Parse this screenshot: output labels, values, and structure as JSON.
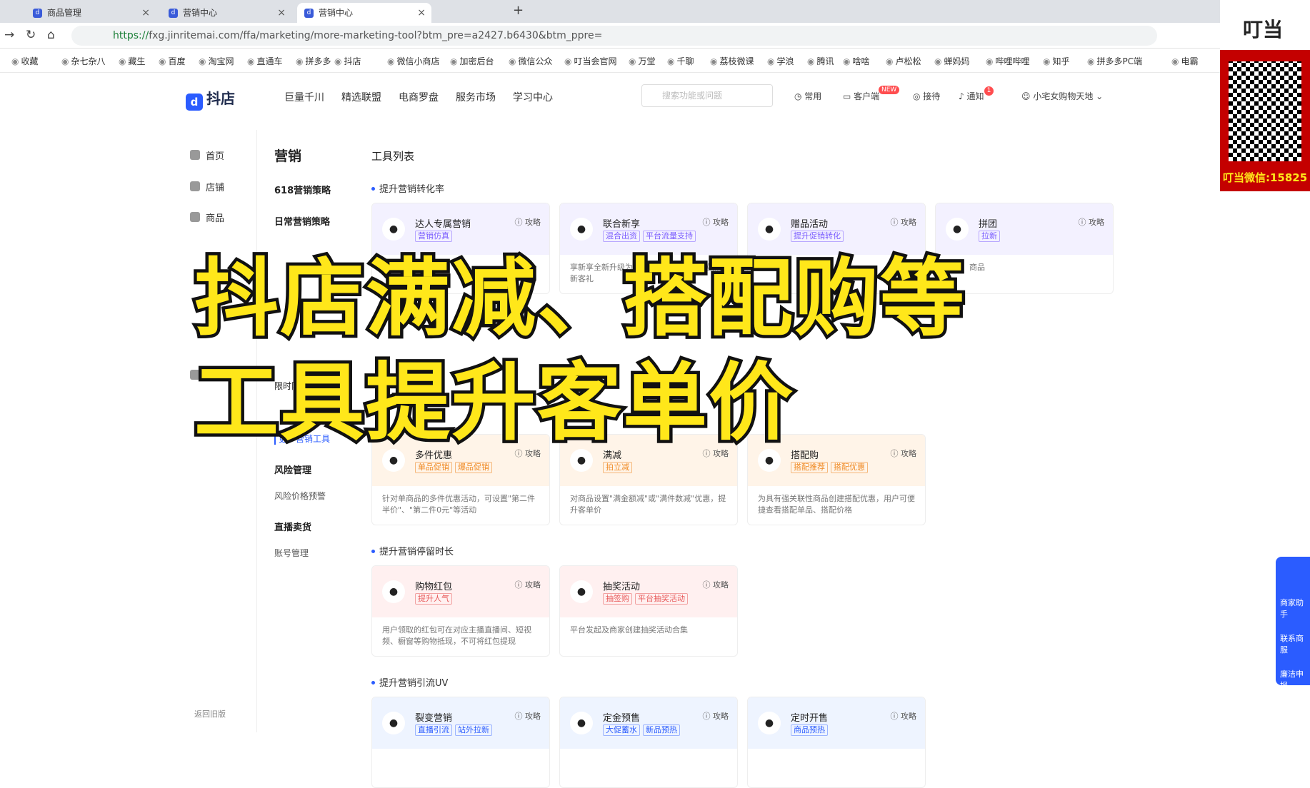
{
  "tabs": [
    {
      "label": "商品管理"
    },
    {
      "label": "营销中心"
    },
    {
      "label": "营销中心"
    }
  ],
  "address": {
    "url_https": "https://",
    "url_rest": "fxg.jinritemai.com/ffa/marketing/more-marketing-tool?btm_pre=a2427.b6430&btm_ppre="
  },
  "bookmarks": [
    "收藏",
    "杂七杂八",
    "藏生",
    "百度",
    "淘宝网",
    "直通车",
    "拼多多",
    "抖店",
    "微信小商店",
    "加密后台",
    "微信公众",
    "叮当会官网",
    "万堂",
    "千聊",
    "荔枝微课",
    "学浪",
    "腾讯",
    "啥啥",
    "卢松松",
    "蝉妈妈",
    "哔哩哔哩",
    "知乎",
    "拼多多PC端",
    "电霸"
  ],
  "header": {
    "logo": "抖店",
    "nav": [
      "巨量千川",
      "精选联盟",
      "电商罗盘",
      "服务市场",
      "学习中心"
    ],
    "search_placeholder": "搜索功能或问题",
    "right": [
      "常用",
      "客户端",
      "接待",
      "通知",
      "小宅女购物天地"
    ],
    "new_badge": "NEW",
    "notify_count": "1"
  },
  "leftnav": {
    "items": [
      "首页",
      "店铺",
      "商品",
      "用户"
    ],
    "footer": "返回旧版"
  },
  "subnav": {
    "title": "营销",
    "items": [
      "618营销策略",
      "日常营销策略",
      "更多营销工具",
      "风险管理",
      "风险价格预警",
      "直播卖货",
      "账号管理",
      "限时限"
    ]
  },
  "main": {
    "title": "工具列表",
    "sections": [
      {
        "title": "提升营销转化率"
      },
      {
        "title": "提升营销停留时长"
      },
      {
        "title": "提升营销引流UV"
      }
    ],
    "cards_row1": [
      {
        "name": "达人专属营销",
        "guide": "攻略",
        "tags": [
          "营销仿真"
        ],
        "desc": ""
      },
      {
        "name": "联合新享",
        "guide": "攻略",
        "tags": [
          "混合出资",
          "平台流量支持"
        ],
        "desc": "享新享全新升级为「店铺新享平台联合拉新提新客礼"
      },
      {
        "name": "赠品活动",
        "guide": "攻略",
        "tags": [
          "提升促销转化"
        ],
        "desc": ""
      },
      {
        "name": "拼团",
        "guide": "攻略",
        "tags": [
          "拉新"
        ],
        "desc": "期间，商品"
      }
    ],
    "cards_row2": [
      {
        "name": "多件优惠",
        "guide": "攻略",
        "tags": [
          "单品促销",
          "爆品促销"
        ],
        "desc": "针对单商品的多件优惠活动，可设置\"第二件半价\"、\"第二件0元\"等活动"
      },
      {
        "name": "满减",
        "guide": "攻略",
        "tags": [
          "拍立减"
        ],
        "desc": "对商品设置\"满金额减\"或\"满件数减\"优惠，提升客单价"
      },
      {
        "name": "搭配购",
        "guide": "攻略",
        "tags": [
          "搭配推荐",
          "搭配优惠"
        ],
        "desc": "为具有强关联性商品创建搭配优惠，用户可便捷查看搭配单品、搭配价格"
      }
    ],
    "cards_row3": [
      {
        "name": "购物红包",
        "guide": "攻略",
        "tags": [
          "提升人气"
        ],
        "desc": "用户领取的红包可在对应主播直播间、短视频、橱窗等购物抵现，不可将红包提现"
      },
      {
        "name": "抽奖活动",
        "guide": "攻略",
        "tags": [
          "抽签购",
          "平台抽奖活动"
        ],
        "desc": "平台发起及商家创建抽奖活动合集"
      }
    ],
    "cards_row4": [
      {
        "name": "裂变营销",
        "guide": "攻略",
        "tags": [
          "直播引流",
          "站外拉新"
        ]
      },
      {
        "name": "定金预售",
        "guide": "攻略",
        "tags": [
          "大促蓄水",
          "新品预热"
        ]
      },
      {
        "name": "定时开售",
        "guide": "攻略",
        "tags": [
          "商品预热"
        ]
      }
    ]
  },
  "overlay": {
    "line1": "抖店满减、搭配购等",
    "line2": "工具提升客单价"
  },
  "promo": {
    "logo": "叮当",
    "wechat": "叮当微信:15825"
  },
  "helper": {
    "items": [
      "商家助手",
      "联系商服",
      "廉洁申报"
    ]
  }
}
